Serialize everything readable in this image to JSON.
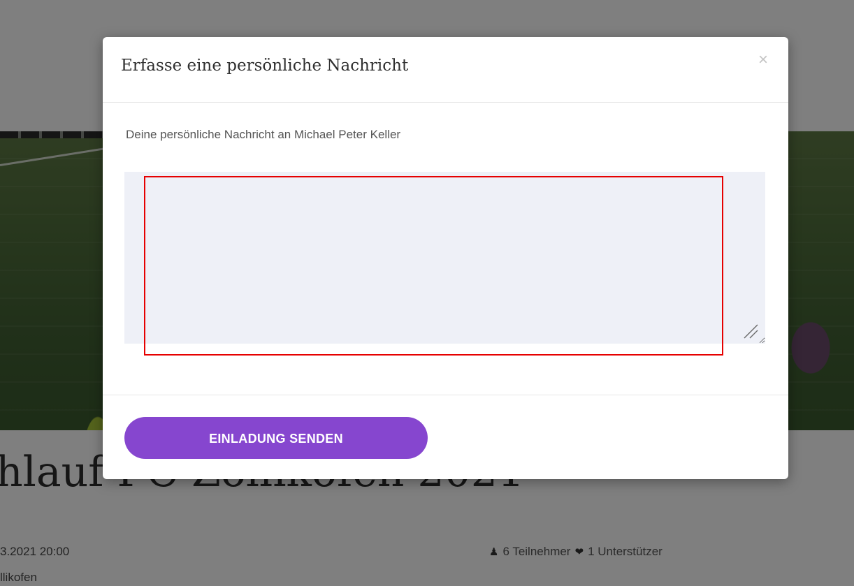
{
  "background_page": {
    "event_title": "hlauf FC Zollikofen 2021",
    "date_time": "3.2021 20:00",
    "location": "llikofen",
    "participants": "6 Teilnehmer",
    "supporters": "1 Unterstützer",
    "icons": {
      "participants": "user-icon",
      "supporters": "heart-icon"
    }
  },
  "modal": {
    "title": "Erfasse eine persönliche Nachricht",
    "close_glyph": "×",
    "message_label": "Deine persönliche Nachricht an Michael Peter Keller",
    "message_value": "",
    "send_button_label": "EINLADUNG SENDEN"
  },
  "colors": {
    "accent": "#8646cf",
    "textarea_bg": "#eef0f7",
    "highlight": "#e60000"
  }
}
